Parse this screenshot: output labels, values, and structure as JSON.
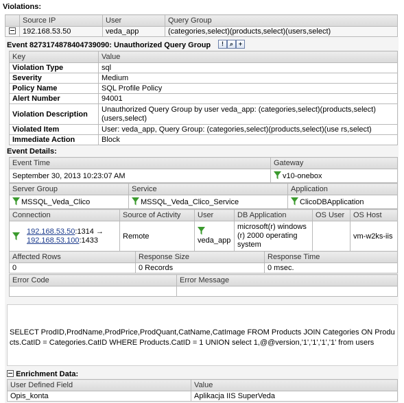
{
  "violations": {
    "title": "Violations:",
    "headers": {
      "source_ip": "Source IP",
      "user": "User",
      "query_group": "Query Group"
    },
    "row": {
      "source_ip": "192.168.53.50",
      "user": "veda_app",
      "query_group": "(categories,select)(products,select)(users,select)"
    }
  },
  "event": {
    "title": "Event  8273174878404739090:  Unauthorized Query Group",
    "buttons": {
      "info": "!",
      "search": "⌕",
      "add": "+"
    },
    "headers": {
      "key": "Key",
      "value": "Value"
    },
    "rows": [
      {
        "key": "Violation Type",
        "value": "sql"
      },
      {
        "key": "Severity",
        "value": "Medium"
      },
      {
        "key": "Policy Name",
        "value": "SQL Profile Policy"
      },
      {
        "key": "Alert Number",
        "value": "94001"
      },
      {
        "key": "Violation Description",
        "value": "Unauthorized Query Group by user veda_app: (categories,select)(products,select)(users,select)"
      },
      {
        "key": "Violated Item",
        "value": "User: veda_app, Query Group: (categories,select)(products,select)(use rs,select)"
      },
      {
        "key": "Immediate Action",
        "value": "Block"
      }
    ]
  },
  "details": {
    "title": "Event Details:",
    "event_time": {
      "label": "Event Time",
      "value": "September 30, 2013 10:23:07 AM"
    },
    "gateway": {
      "label": "Gateway",
      "value": "v10-onebox"
    },
    "server_group": {
      "label": "Server Group",
      "value": "MSSQL_Veda_Clico"
    },
    "service": {
      "label": "Service",
      "value": "MSSQL_Veda_Clico_Service"
    },
    "application": {
      "label": "Application",
      "value": "ClicoDBApplication"
    },
    "connection": {
      "headers": {
        "connection": "Connection",
        "source": "Source of Activity",
        "user": "User",
        "db_app": "DB Application",
        "os_user": "OS User",
        "os_host": "OS Host"
      },
      "src_ip": "192.168.53.50",
      "src_port": ":1314 →",
      "dst_ip": "192.168.53.100",
      "dst_port": ":1433",
      "source": "Remote",
      "user": "veda_app",
      "db_app": "microsoft(r) windows (r) 2000 operating system",
      "os_user": "",
      "os_host": "vm-w2ks-iis"
    },
    "affected_rows": {
      "label": "Affected Rows",
      "value": "0"
    },
    "response_size": {
      "label": "Response Size",
      "value": "0  Records"
    },
    "response_time": {
      "label": "Response Time",
      "value": "0  msec."
    },
    "error_code": {
      "label": "Error Code",
      "value": ""
    },
    "error_message": {
      "label": "Error Message",
      "value": ""
    },
    "sql": "SELECT ProdID,ProdName,ProdPrice,ProdQuant,CatName,CatImage FROM Products JOIN Categories ON Products.CatID = Categories.CatID WHERE Products.CatID = 1 UNION select 1,@@version,'1','1','1','1' from users"
  },
  "enrichment": {
    "title": "Enrichment Data:",
    "headers": {
      "field": "User Defined Field",
      "value": "Value"
    },
    "row": {
      "field": "Opis_konta",
      "value": "Aplikacja IIS SuperVeda"
    }
  },
  "colors": {
    "filter_icon": "#3b9a2e",
    "link": "#1a3a8c",
    "header_bg": "#dcdcdc",
    "panel_bg": "#f4f4f4"
  }
}
